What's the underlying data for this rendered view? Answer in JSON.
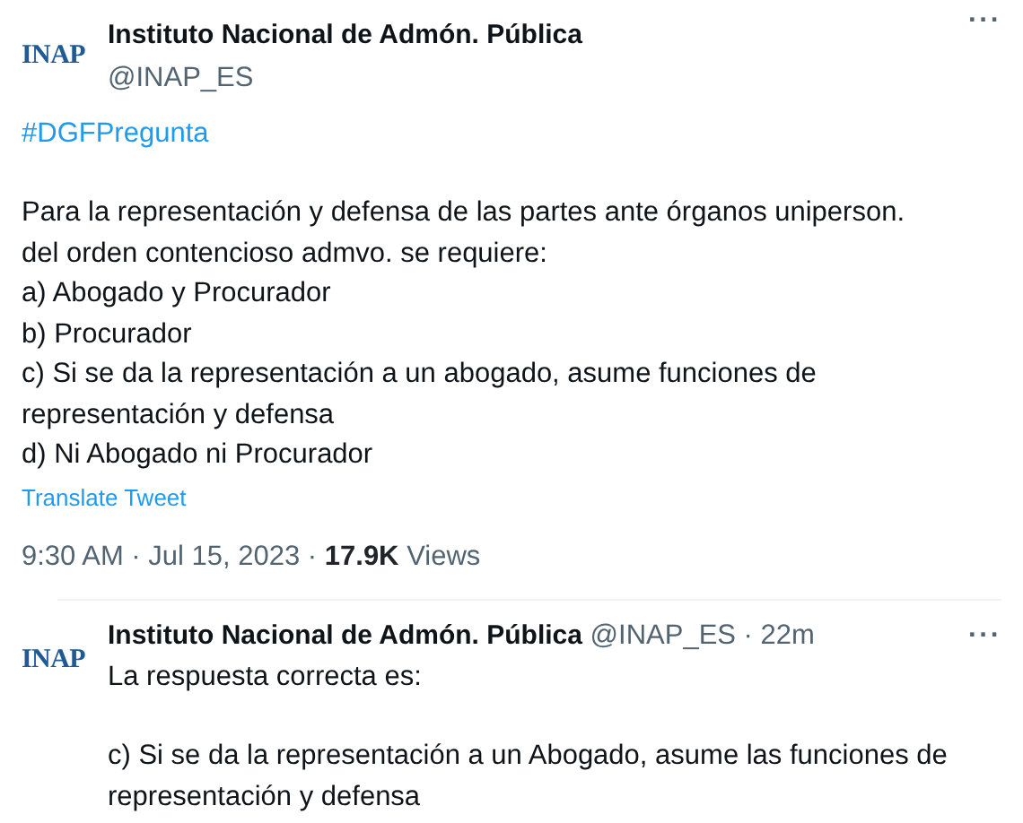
{
  "tweet": {
    "avatar_text": "INAP",
    "name": "Instituto Nacional de Admón. Pública",
    "handle": "@INAP_ES",
    "more": "···",
    "hashtag": "#DGFPregunta",
    "paragraphs": [
      {
        "lines": [
          "Para la representación y defensa de las partes ante órganos uniperson.",
          "del orden contencioso admvo. se requiere:"
        ]
      },
      {
        "lines": [
          "a) Abogado y Procurador"
        ]
      },
      {
        "lines": [
          "b) Procurador"
        ]
      },
      {
        "lines": [
          "c) Si se da la representación a un abogado, asume funciones de",
          "representación y defensa"
        ]
      },
      {
        "lines": [
          "d) Ni Abogado ni Procurador"
        ]
      }
    ],
    "translate": "Translate Tweet",
    "time": "9:30 AM · Jul 15, 2023 ·",
    "views_count": "17.9K",
    "views_label": "Views"
  },
  "reply": {
    "avatar_text": "INAP",
    "name": "Instituto Nacional de Admón. Pública",
    "handle": "@INAP_ES · 22m",
    "more": "···",
    "paragraphs": [
      {
        "lines": [
          "La respuesta correcta es:"
        ]
      },
      {
        "lines": [
          "c) Si se da la representación a un Abogado, asume las funciones de",
          "representación y defensa"
        ]
      }
    ]
  }
}
